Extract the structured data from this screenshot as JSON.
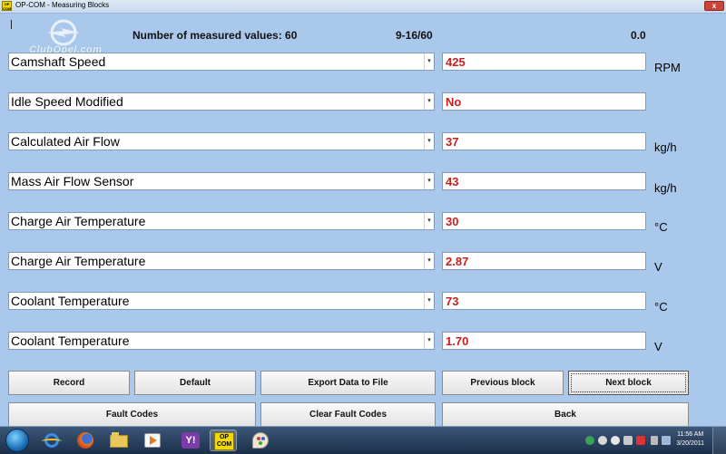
{
  "window": {
    "title": "OP-COM - Measuring Blocks",
    "icon_text": "OP COM",
    "close_label": "x"
  },
  "header": {
    "logo_text": "ClubOpel.com",
    "measured_count_text": "Number of measured values: 60",
    "range_text": "9-16/60",
    "value_text": "0.0"
  },
  "rows": [
    {
      "label": "Camshaft Speed",
      "value": "425",
      "unit": "RPM"
    },
    {
      "label": "Idle Speed Modified",
      "value": "No",
      "unit": ""
    },
    {
      "label": "Calculated Air Flow",
      "value": "37",
      "unit": "kg/h"
    },
    {
      "label": "Mass Air Flow Sensor",
      "value": "43",
      "unit": "kg/h"
    },
    {
      "label": "Charge Air Temperature",
      "value": "30",
      "unit": "°C"
    },
    {
      "label": "Charge Air Temperature",
      "value": "2.87",
      "unit": "V"
    },
    {
      "label": "Coolant Temperature",
      "value": "73",
      "unit": "°C"
    },
    {
      "label": "Coolant Temperature",
      "value": "1.70",
      "unit": "V"
    }
  ],
  "buttons": {
    "record": "Record",
    "default": "Default",
    "export": "Export Data to File",
    "previous_block": "Previous block",
    "next_block": "Next block",
    "fault_codes": "Fault Codes",
    "clear_fault_codes": "Clear Fault Codes",
    "back": "Back"
  },
  "taskbar": {
    "items": [
      "start-orb",
      "internet-explorer-icon",
      "firefox-icon",
      "file-explorer-icon",
      "media-player-icon",
      "yahoo-messenger-icon",
      "opcom-icon",
      "paint-icon"
    ],
    "opcom_label": "OP COM",
    "mail_label": "Y!",
    "clock_time": "11:56 AM",
    "clock_date": "3/20/2011"
  },
  "colors": {
    "background": "#a9c8ec",
    "value_text": "#cc1d1d",
    "taskbar": "#1b2f49"
  }
}
